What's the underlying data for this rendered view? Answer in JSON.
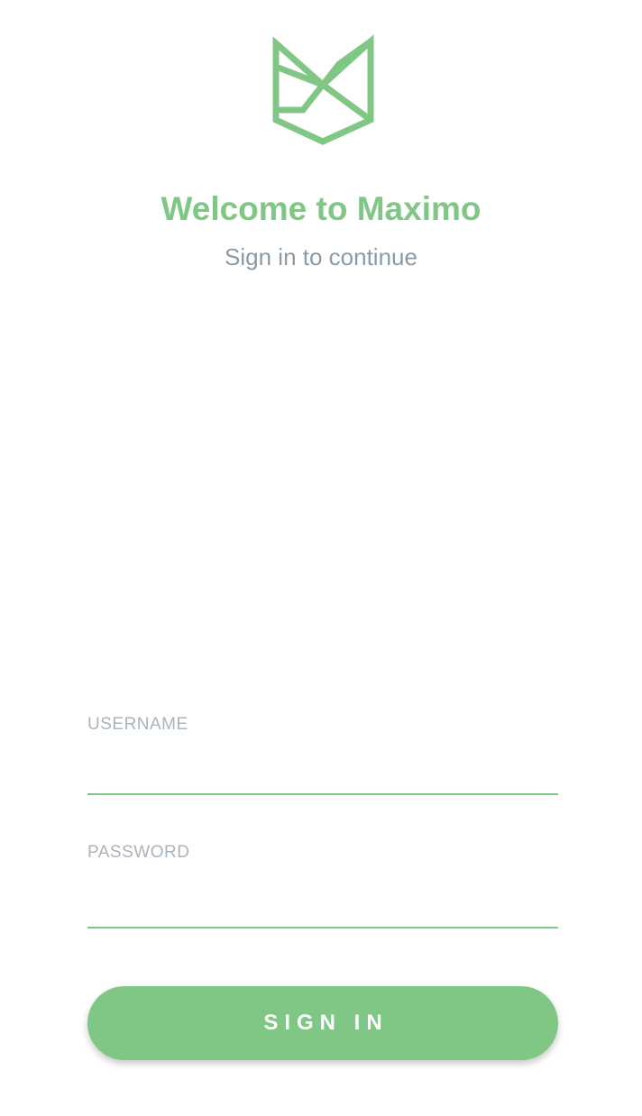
{
  "brand": {
    "logo_icon": "maximo-logo-icon",
    "accent_color": "#80c785"
  },
  "header": {
    "title": "Welcome to Maximo",
    "subtitle": "Sign in to continue"
  },
  "form": {
    "username": {
      "label": "USERNAME",
      "value": ""
    },
    "password": {
      "label": "PASSWORD",
      "value": ""
    },
    "submit_label": "SIGN IN"
  }
}
